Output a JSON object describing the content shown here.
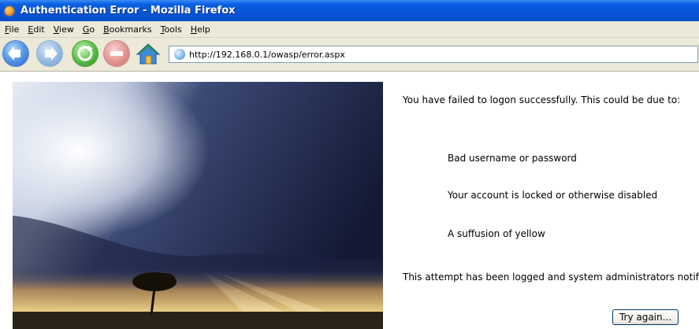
{
  "window": {
    "title": "Authentication Error - Mozilla Firefox"
  },
  "menu": [
    {
      "label": "File",
      "accel": "F",
      "rest": "ile"
    },
    {
      "label": "Edit",
      "accel": "E",
      "rest": "dit"
    },
    {
      "label": "View",
      "accel": "V",
      "rest": "iew"
    },
    {
      "label": "Go",
      "accel": "G",
      "rest": "o"
    },
    {
      "label": "Bookmarks",
      "accel": "B",
      "rest": "ookmarks"
    },
    {
      "label": "Tools",
      "accel": "T",
      "rest": "ools"
    },
    {
      "label": "Help",
      "accel": "H",
      "rest": "elp"
    }
  ],
  "toolbar": {
    "back_icon": "back-arrow-icon",
    "forward_icon": "forward-arrow-icon",
    "reload_icon": "reload-icon",
    "stop_icon": "stop-icon",
    "home_icon": "home-icon"
  },
  "address": {
    "url": "http://192.168.0.1/owasp/error.aspx"
  },
  "page": {
    "intro": "You have failed to logon successfully. This could be due to:",
    "reasons": [
      "Bad username or password",
      "Your account is locked or otherwise disabled",
      "A suffusion of yellow"
    ],
    "notice": "This attempt has been logged and system administrators notified.",
    "try_again": "Try again..."
  },
  "colors": {
    "titlebar": "#0553d6",
    "chrome": "#ece9d8",
    "button_border": "#003c74"
  }
}
